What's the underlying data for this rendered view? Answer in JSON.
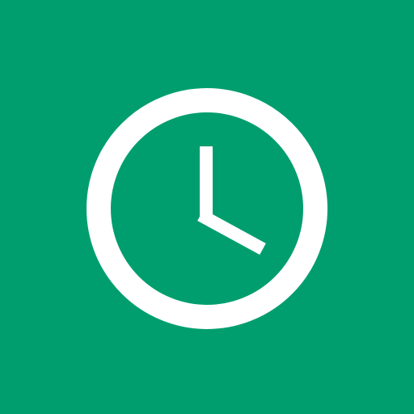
{
  "app_icon": {
    "icon": "clock-icon",
    "colors": {
      "background": "#009E6E",
      "foreground": "#FFFFFF"
    }
  }
}
